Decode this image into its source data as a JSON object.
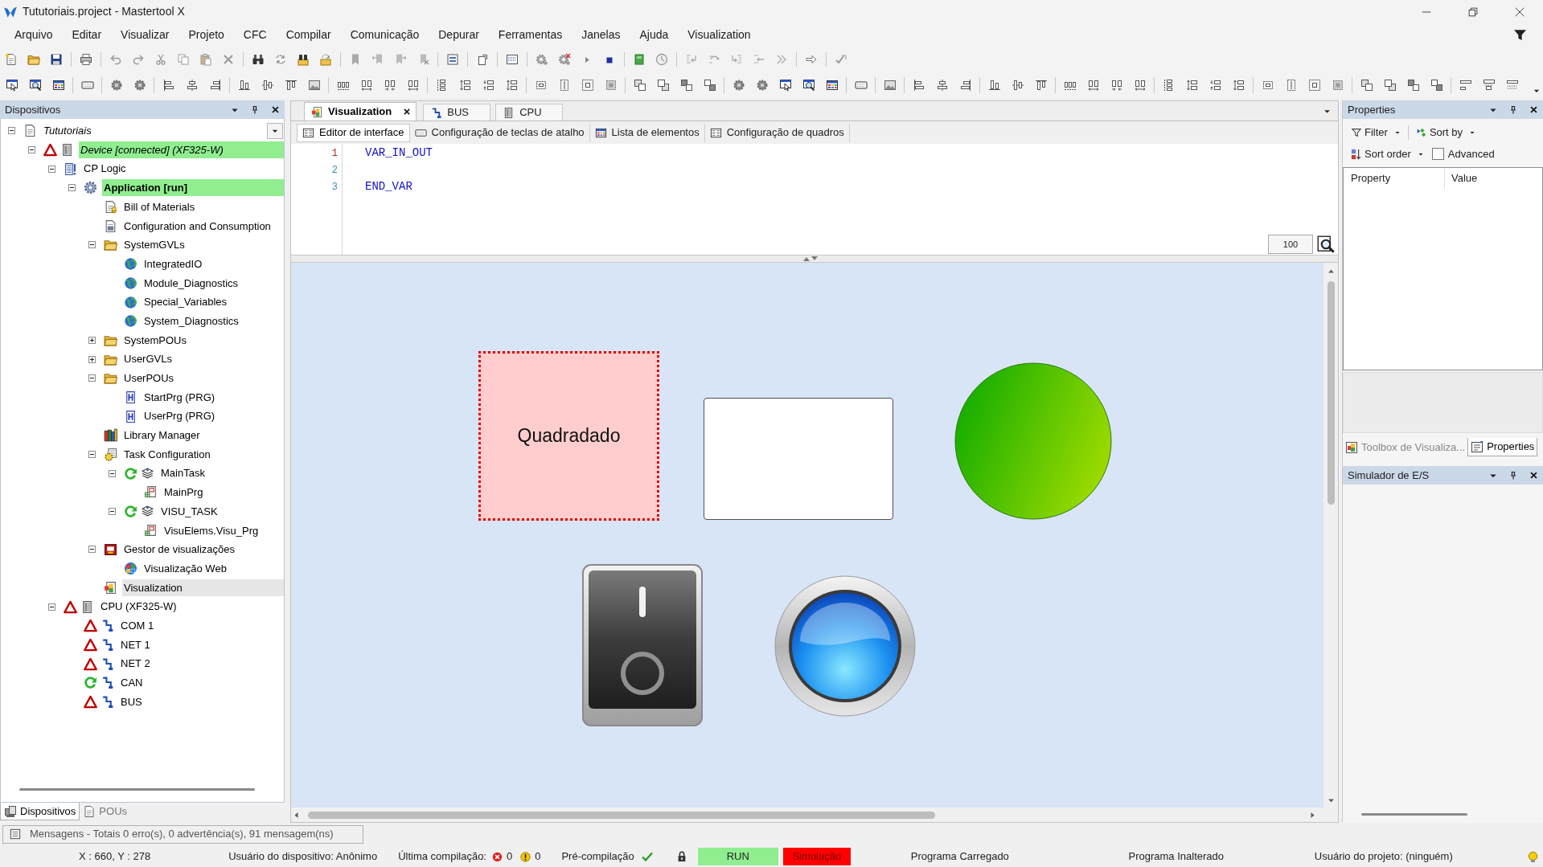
{
  "window": {
    "title": "Tututoriais.project - Mastertool X"
  },
  "menu": [
    "Arquivo",
    "Editar",
    "Visualizar",
    "Projeto",
    "CFC",
    "Compilar",
    "Comunicação",
    "Depurar",
    "Ferramentas",
    "Janelas",
    "Ajuda",
    "Visualization"
  ],
  "devices_panel": {
    "title": "Dispositivos",
    "tree": [
      {
        "label": "Tututoriais",
        "kind": "project",
        "selected": false,
        "expanded": true,
        "children": [
          {
            "label": "Device [connected] (XF325-W)",
            "kind": "device",
            "error": true,
            "connected": true,
            "selected": false,
            "expanded": true,
            "children": [
              {
                "label": "CP Logic",
                "kind": "plc-logic",
                "selected": false,
                "expanded": true,
                "children": [
                  {
                    "label": "Application [run]",
                    "kind": "application",
                    "active": true,
                    "selected": false,
                    "expanded": true,
                    "children": [
                      {
                        "label": "Bill of Materials",
                        "kind": "bill",
                        "selected": false
                      },
                      {
                        "label": "Configuration and Consumption",
                        "kind": "config",
                        "selected": false
                      },
                      {
                        "label": "SystemGVLs",
                        "kind": "folder",
                        "selected": false,
                        "expanded": true,
                        "children": [
                          {
                            "label": "IntegratedIO",
                            "kind": "gvl",
                            "selected": false
                          },
                          {
                            "label": "Module_Diagnostics",
                            "kind": "gvl",
                            "selected": false
                          },
                          {
                            "label": "Special_Variables",
                            "kind": "gvl",
                            "selected": false
                          },
                          {
                            "label": "System_Diagnostics",
                            "kind": "gvl",
                            "selected": false
                          }
                        ]
                      },
                      {
                        "label": "SystemPOUs",
                        "kind": "folder",
                        "selected": false,
                        "expanded": false
                      },
                      {
                        "label": "UserGVLs",
                        "kind": "folder",
                        "selected": false,
                        "expanded": false
                      },
                      {
                        "label": "UserPOUs",
                        "kind": "folder",
                        "selected": false,
                        "expanded": true,
                        "children": [
                          {
                            "label": "StartPrg (PRG)",
                            "kind": "pou",
                            "selected": false
                          },
                          {
                            "label": "UserPrg (PRG)",
                            "kind": "pou",
                            "selected": false
                          }
                        ]
                      },
                      {
                        "label": "Library Manager",
                        "kind": "library",
                        "selected": false
                      },
                      {
                        "label": "Task Configuration",
                        "kind": "task-config",
                        "selected": false,
                        "expanded": true,
                        "children": [
                          {
                            "label": "MainTask",
                            "kind": "task",
                            "running": true,
                            "selected": false,
                            "expanded": true,
                            "children": [
                              {
                                "label": "MainPrg",
                                "kind": "call",
                                "selected": false
                              }
                            ]
                          },
                          {
                            "label": "VISU_TASK",
                            "kind": "task",
                            "running": true,
                            "selected": false,
                            "expanded": true,
                            "children": [
                              {
                                "label": "VisuElems.Visu_Prg",
                                "kind": "call",
                                "selected": false
                              }
                            ]
                          }
                        ]
                      },
                      {
                        "label": "Gestor de visualizações",
                        "kind": "visu-manager",
                        "selected": false,
                        "expanded": true,
                        "children": [
                          {
                            "label": "Visualização Web",
                            "kind": "web-visu",
                            "selected": false
                          }
                        ]
                      },
                      {
                        "label": "Visualization",
                        "kind": "visu",
                        "selected": true
                      }
                    ]
                  }
                ]
              },
              {
                "label": "CPU (XF325-W)",
                "kind": "device",
                "error": true,
                "connected": false,
                "selected": false,
                "expanded": true,
                "children": [
                  {
                    "label": "COM 1",
                    "kind": "port",
                    "error": true,
                    "selected": false
                  },
                  {
                    "label": "NET 1",
                    "kind": "port",
                    "error": true,
                    "selected": false
                  },
                  {
                    "label": "NET 2",
                    "kind": "port",
                    "error": true,
                    "selected": false
                  },
                  {
                    "label": "CAN",
                    "kind": "port",
                    "running": true,
                    "selected": false
                  },
                  {
                    "label": "BUS",
                    "kind": "port",
                    "error": true,
                    "selected": false
                  }
                ]
              }
            ]
          }
        ]
      }
    ],
    "tabs": [
      {
        "label": "Dispositivos",
        "selected": true
      },
      {
        "label": "POUs",
        "selected": false
      }
    ]
  },
  "editor": {
    "tabs": [
      {
        "label": "Visualization",
        "kind": "visu",
        "selected": true
      },
      {
        "label": "BUS",
        "kind": "port",
        "selected": false
      },
      {
        "label": "CPU",
        "kind": "device",
        "selected": false
      }
    ],
    "subtabs": [
      {
        "label": "Editor de interface",
        "selected": true
      },
      {
        "label": "Configuração de teclas de atalho",
        "selected": false
      },
      {
        "label": "Lista de elementos",
        "selected": false
      },
      {
        "label": "Configuração de quadros",
        "selected": false
      }
    ],
    "code": [
      {
        "number": "1",
        "text": "VAR_IN_OUT",
        "current": true
      },
      {
        "number": "2",
        "current": false
      },
      {
        "number": "3",
        "text": "END_VAR",
        "current": false
      }
    ],
    "zoom": "100",
    "canvas": {
      "elements": [
        {
          "kind": "label-box",
          "label": "Quadradado"
        },
        {
          "kind": "box"
        },
        {
          "kind": "ellipse"
        },
        {
          "kind": "switch"
        },
        {
          "kind": "lamp"
        }
      ]
    }
  },
  "properties_panel": {
    "title": "Properties",
    "toolbar": [
      "Filter",
      "Sort by",
      "Sort order"
    ],
    "advanced": {
      "label": "Advanced",
      "checked": false
    },
    "columns": [
      "Property",
      "Value"
    ],
    "tabs": [
      {
        "label": "Toolbox de Visualiza...",
        "selected": false
      },
      {
        "label": "Properties",
        "selected": true
      }
    ]
  },
  "io_simulator_panel": {
    "title": "Simulador de E/S"
  },
  "messages_bar": {
    "text": "Mensagens - Totais 0 erro(s), 0 advertência(s), 91 mensagem(ns)"
  },
  "status_bar": {
    "cursor": "X : 660, Y : 278",
    "device_user": "Usuário do dispositivo: Anônimo",
    "last_compile": {
      "label": "Última compilação:",
      "errors": "0",
      "warnings": "0"
    },
    "precompile": {
      "label": "Pré-compilação",
      "ok": true
    },
    "run": {
      "label": "RUN",
      "on": true
    },
    "simulation": {
      "label": "Simulação",
      "on": true
    },
    "program_state": "Programa Carregado",
    "program_changes": "Programa Inalterado",
    "project_user": "Usuário do projeto: (ninguém)"
  }
}
